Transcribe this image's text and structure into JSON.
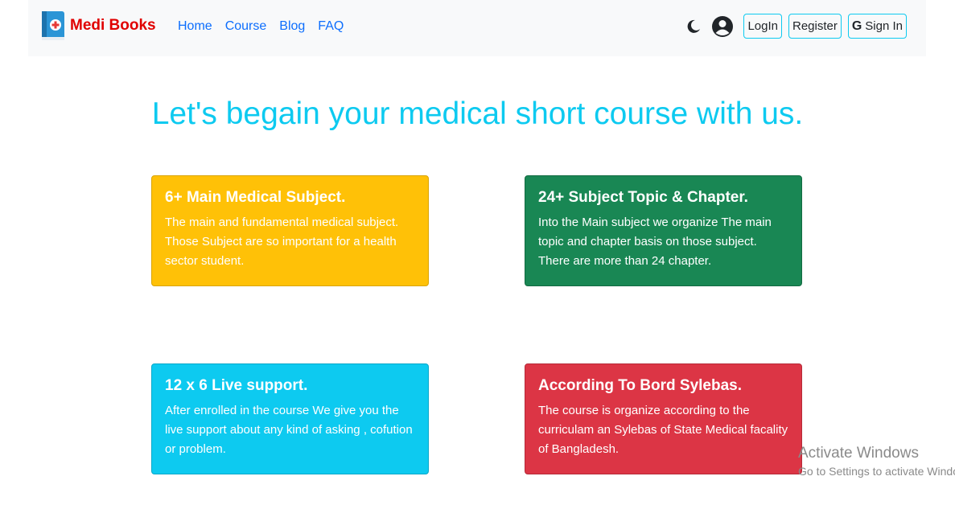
{
  "brand": {
    "name": "Medi Books",
    "logo_icon": "medical-book-icon",
    "color": "#e00000"
  },
  "nav": {
    "links": [
      "Home",
      "Course",
      "Blog",
      "FAQ"
    ]
  },
  "actions": {
    "theme_icon": "moon-icon",
    "user_icon": "user-circle-icon",
    "login": "LogIn",
    "register": "Register",
    "google_icon": "google-icon",
    "signin": "Sign In"
  },
  "headline": "Let's begain your medical short course with us.",
  "cards": [
    {
      "title": "6+ Main Medical Subject.",
      "text": "The main and fundamental medical subject. Those Subject are so important for a health sector student.",
      "color": "#ffc107"
    },
    {
      "title": "24+ Subject Topic & Chapter.",
      "text": "Into the Main subject we organize The main topic and chapter basis on those subject. There are more than 24 chapter.",
      "color": "#198754"
    },
    {
      "title": "12 x 6 Live support.",
      "text": "After enrolled in the course We give you the live support about any kind of asking , cofution or problem.",
      "color": "#0dcaf0"
    },
    {
      "title": "According To Bord Sylebas.",
      "text": "The course is organize according to the curriculam an Sylebas of State Medical facality of Bangladesh.",
      "color": "#dc3545"
    }
  ],
  "watermark": {
    "title": "Activate Windows",
    "subtitle": "Go to Settings to activate Windows."
  }
}
